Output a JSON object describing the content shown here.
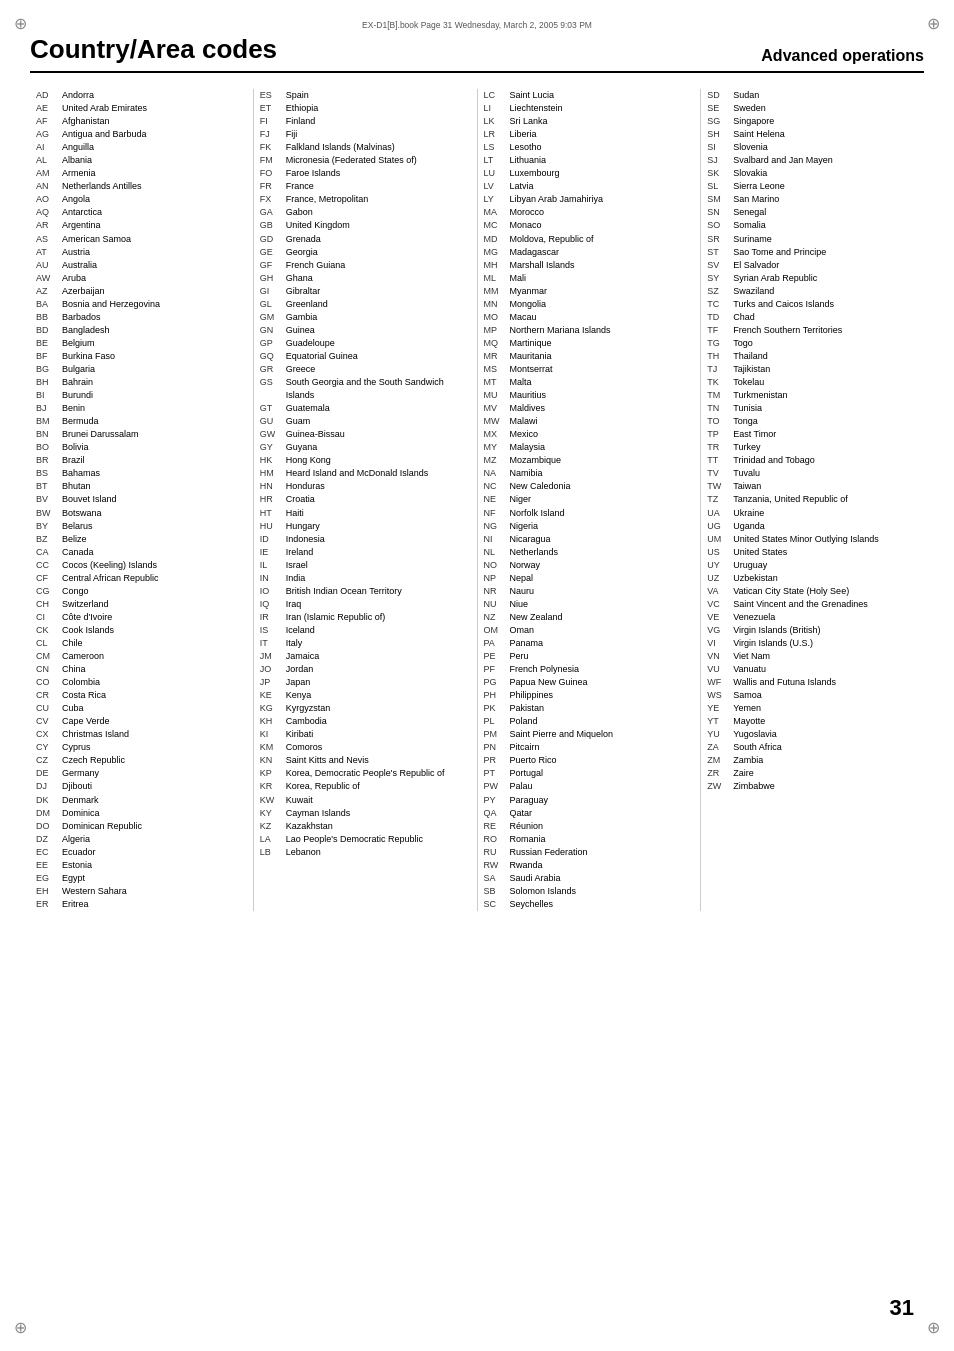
{
  "meta": {
    "top_info": "EX-D1[B].book  Page 31  Wednesday, March 2, 2005  9:03 PM",
    "title": "Country/Area codes",
    "subtitle": "Advanced operations",
    "page_number": "31"
  },
  "columns": [
    [
      {
        "code": "AD",
        "name": "Andorra"
      },
      {
        "code": "AE",
        "name": "United Arab Emirates"
      },
      {
        "code": "AF",
        "name": "Afghanistan"
      },
      {
        "code": "AG",
        "name": "Antigua and Barbuda"
      },
      {
        "code": "AI",
        "name": "Anguilla"
      },
      {
        "code": "AL",
        "name": "Albania"
      },
      {
        "code": "AM",
        "name": "Armenia"
      },
      {
        "code": "AN",
        "name": "Netherlands Antilles"
      },
      {
        "code": "AO",
        "name": "Angola"
      },
      {
        "code": "AQ",
        "name": "Antarctica"
      },
      {
        "code": "AR",
        "name": "Argentina"
      },
      {
        "code": "AS",
        "name": "American Samoa"
      },
      {
        "code": "AT",
        "name": "Austria"
      },
      {
        "code": "AU",
        "name": "Australia"
      },
      {
        "code": "AW",
        "name": "Aruba"
      },
      {
        "code": "AZ",
        "name": "Azerbaijan"
      },
      {
        "code": "BA",
        "name": "Bosnia and Herzegovina"
      },
      {
        "code": "BB",
        "name": "Barbados"
      },
      {
        "code": "BD",
        "name": "Bangladesh"
      },
      {
        "code": "BE",
        "name": "Belgium"
      },
      {
        "code": "BF",
        "name": "Burkina Faso"
      },
      {
        "code": "BG",
        "name": "Bulgaria"
      },
      {
        "code": "BH",
        "name": "Bahrain"
      },
      {
        "code": "BI",
        "name": "Burundi"
      },
      {
        "code": "BJ",
        "name": "Benin"
      },
      {
        "code": "BM",
        "name": "Bermuda"
      },
      {
        "code": "BN",
        "name": "Brunei Darussalam"
      },
      {
        "code": "BO",
        "name": "Bolivia"
      },
      {
        "code": "BR",
        "name": "Brazil"
      },
      {
        "code": "BS",
        "name": "Bahamas"
      },
      {
        "code": "BT",
        "name": "Bhutan"
      },
      {
        "code": "BV",
        "name": "Bouvet Island"
      },
      {
        "code": "BW",
        "name": "Botswana"
      },
      {
        "code": "BY",
        "name": "Belarus"
      },
      {
        "code": "BZ",
        "name": "Belize"
      },
      {
        "code": "CA",
        "name": "Canada"
      },
      {
        "code": "CC",
        "name": "Cocos (Keeling) Islands"
      },
      {
        "code": "CF",
        "name": "Central African Republic"
      },
      {
        "code": "CG",
        "name": "Congo"
      },
      {
        "code": "CH",
        "name": "Switzerland"
      },
      {
        "code": "CI",
        "name": "Côte d'Ivoire"
      },
      {
        "code": "CK",
        "name": "Cook Islands"
      },
      {
        "code": "CL",
        "name": "Chile"
      },
      {
        "code": "CM",
        "name": "Cameroon"
      },
      {
        "code": "CN",
        "name": "China"
      },
      {
        "code": "CO",
        "name": "Colombia"
      },
      {
        "code": "CR",
        "name": "Costa Rica"
      },
      {
        "code": "CU",
        "name": "Cuba"
      },
      {
        "code": "CV",
        "name": "Cape Verde"
      },
      {
        "code": "CX",
        "name": "Christmas Island"
      },
      {
        "code": "CY",
        "name": "Cyprus"
      },
      {
        "code": "CZ",
        "name": "Czech Republic"
      },
      {
        "code": "DE",
        "name": "Germany"
      },
      {
        "code": "DJ",
        "name": "Djibouti"
      },
      {
        "code": "DK",
        "name": "Denmark"
      },
      {
        "code": "DM",
        "name": "Dominica"
      },
      {
        "code": "DO",
        "name": "Dominican Republic"
      },
      {
        "code": "DZ",
        "name": "Algeria"
      },
      {
        "code": "EC",
        "name": "Ecuador"
      },
      {
        "code": "EE",
        "name": "Estonia"
      },
      {
        "code": "EG",
        "name": "Egypt"
      },
      {
        "code": "EH",
        "name": "Western Sahara"
      },
      {
        "code": "ER",
        "name": "Eritrea"
      }
    ],
    [
      {
        "code": "ES",
        "name": "Spain"
      },
      {
        "code": "ET",
        "name": "Ethiopia"
      },
      {
        "code": "FI",
        "name": "Finland"
      },
      {
        "code": "FJ",
        "name": "Fiji"
      },
      {
        "code": "FK",
        "name": "Falkland Islands (Malvinas)"
      },
      {
        "code": "FM",
        "name": "Micronesia (Federated States of)"
      },
      {
        "code": "FO",
        "name": "Faroe Islands"
      },
      {
        "code": "FR",
        "name": "France"
      },
      {
        "code": "FX",
        "name": "France, Metropolitan"
      },
      {
        "code": "GA",
        "name": "Gabon"
      },
      {
        "code": "GB",
        "name": "United Kingdom"
      },
      {
        "code": "GD",
        "name": "Grenada"
      },
      {
        "code": "GE",
        "name": "Georgia"
      },
      {
        "code": "GF",
        "name": "French Guiana"
      },
      {
        "code": "GH",
        "name": "Ghana"
      },
      {
        "code": "GI",
        "name": "Gibraltar"
      },
      {
        "code": "GL",
        "name": "Greenland"
      },
      {
        "code": "GM",
        "name": "Gambia"
      },
      {
        "code": "GN",
        "name": "Guinea"
      },
      {
        "code": "GP",
        "name": "Guadeloupe"
      },
      {
        "code": "GQ",
        "name": "Equatorial Guinea"
      },
      {
        "code": "GR",
        "name": "Greece"
      },
      {
        "code": "GS",
        "name": "South Georgia and the South Sandwich Islands"
      },
      {
        "code": "GT",
        "name": "Guatemala"
      },
      {
        "code": "GU",
        "name": "Guam"
      },
      {
        "code": "GW",
        "name": "Guinea-Bissau"
      },
      {
        "code": "GY",
        "name": "Guyana"
      },
      {
        "code": "HK",
        "name": "Hong Kong"
      },
      {
        "code": "HM",
        "name": "Heard Island and McDonald Islands"
      },
      {
        "code": "HN",
        "name": "Honduras"
      },
      {
        "code": "HR",
        "name": "Croatia"
      },
      {
        "code": "HT",
        "name": "Haiti"
      },
      {
        "code": "HU",
        "name": "Hungary"
      },
      {
        "code": "ID",
        "name": "Indonesia"
      },
      {
        "code": "IE",
        "name": "Ireland"
      },
      {
        "code": "IL",
        "name": "Israel"
      },
      {
        "code": "IN",
        "name": "India"
      },
      {
        "code": "IO",
        "name": "British Indian Ocean Territory"
      },
      {
        "code": "IQ",
        "name": "Iraq"
      },
      {
        "code": "IR",
        "name": "Iran (Islamic Republic of)"
      },
      {
        "code": "IS",
        "name": "Iceland"
      },
      {
        "code": "IT",
        "name": "Italy"
      },
      {
        "code": "JM",
        "name": "Jamaica"
      },
      {
        "code": "JO",
        "name": "Jordan"
      },
      {
        "code": "JP",
        "name": "Japan"
      },
      {
        "code": "KE",
        "name": "Kenya"
      },
      {
        "code": "KG",
        "name": "Kyrgyzstan"
      },
      {
        "code": "KH",
        "name": "Cambodia"
      },
      {
        "code": "KI",
        "name": "Kiribati"
      },
      {
        "code": "KM",
        "name": "Comoros"
      },
      {
        "code": "KN",
        "name": "Saint Kitts and Nevis"
      },
      {
        "code": "KP",
        "name": "Korea, Democratic People's Republic of"
      },
      {
        "code": "KR",
        "name": "Korea, Republic of"
      },
      {
        "code": "KW",
        "name": "Kuwait"
      },
      {
        "code": "KY",
        "name": "Cayman Islands"
      },
      {
        "code": "KZ",
        "name": "Kazakhstan"
      },
      {
        "code": "LA",
        "name": "Lao People's Democratic Republic"
      },
      {
        "code": "LB",
        "name": "Lebanon"
      }
    ],
    [
      {
        "code": "LC",
        "name": "Saint Lucia"
      },
      {
        "code": "LI",
        "name": "Liechtenstein"
      },
      {
        "code": "LK",
        "name": "Sri Lanka"
      },
      {
        "code": "LR",
        "name": "Liberia"
      },
      {
        "code": "LS",
        "name": "Lesotho"
      },
      {
        "code": "LT",
        "name": "Lithuania"
      },
      {
        "code": "LU",
        "name": "Luxembourg"
      },
      {
        "code": "LV",
        "name": "Latvia"
      },
      {
        "code": "LY",
        "name": "Libyan Arab Jamahiriya"
      },
      {
        "code": "MA",
        "name": "Morocco"
      },
      {
        "code": "MC",
        "name": "Monaco"
      },
      {
        "code": "MD",
        "name": "Moldova, Republic of"
      },
      {
        "code": "MG",
        "name": "Madagascar"
      },
      {
        "code": "MH",
        "name": "Marshall Islands"
      },
      {
        "code": "ML",
        "name": "Mali"
      },
      {
        "code": "MM",
        "name": "Myanmar"
      },
      {
        "code": "MN",
        "name": "Mongolia"
      },
      {
        "code": "MO",
        "name": "Macau"
      },
      {
        "code": "MP",
        "name": "Northern Mariana Islands"
      },
      {
        "code": "MQ",
        "name": "Martinique"
      },
      {
        "code": "MR",
        "name": "Mauritania"
      },
      {
        "code": "MS",
        "name": "Montserrat"
      },
      {
        "code": "MT",
        "name": "Malta"
      },
      {
        "code": "MU",
        "name": "Mauritius"
      },
      {
        "code": "MV",
        "name": "Maldives"
      },
      {
        "code": "MW",
        "name": "Malawi"
      },
      {
        "code": "MX",
        "name": "Mexico"
      },
      {
        "code": "MY",
        "name": "Malaysia"
      },
      {
        "code": "MZ",
        "name": "Mozambique"
      },
      {
        "code": "NA",
        "name": "Namibia"
      },
      {
        "code": "NC",
        "name": "New Caledonia"
      },
      {
        "code": "NE",
        "name": "Niger"
      },
      {
        "code": "NF",
        "name": "Norfolk Island"
      },
      {
        "code": "NG",
        "name": "Nigeria"
      },
      {
        "code": "NI",
        "name": "Nicaragua"
      },
      {
        "code": "NL",
        "name": "Netherlands"
      },
      {
        "code": "NO",
        "name": "Norway"
      },
      {
        "code": "NP",
        "name": "Nepal"
      },
      {
        "code": "NR",
        "name": "Nauru"
      },
      {
        "code": "NU",
        "name": "Niue"
      },
      {
        "code": "NZ",
        "name": "New Zealand"
      },
      {
        "code": "OM",
        "name": "Oman"
      },
      {
        "code": "PA",
        "name": "Panama"
      },
      {
        "code": "PE",
        "name": "Peru"
      },
      {
        "code": "PF",
        "name": "French Polynesia"
      },
      {
        "code": "PG",
        "name": "Papua New Guinea"
      },
      {
        "code": "PH",
        "name": "Philippines"
      },
      {
        "code": "PK",
        "name": "Pakistan"
      },
      {
        "code": "PL",
        "name": "Poland"
      },
      {
        "code": "PM",
        "name": "Saint Pierre and Miquelon"
      },
      {
        "code": "PN",
        "name": "Pitcairn"
      },
      {
        "code": "PR",
        "name": "Puerto Rico"
      },
      {
        "code": "PT",
        "name": "Portugal"
      },
      {
        "code": "PW",
        "name": "Palau"
      },
      {
        "code": "PY",
        "name": "Paraguay"
      },
      {
        "code": "QA",
        "name": "Qatar"
      },
      {
        "code": "RE",
        "name": "Réunion"
      },
      {
        "code": "RO",
        "name": "Romania"
      },
      {
        "code": "RU",
        "name": "Russian Federation"
      },
      {
        "code": "RW",
        "name": "Rwanda"
      },
      {
        "code": "SA",
        "name": "Saudi Arabia"
      },
      {
        "code": "SB",
        "name": "Solomon Islands"
      },
      {
        "code": "SC",
        "name": "Seychelles"
      }
    ],
    [
      {
        "code": "SD",
        "name": "Sudan"
      },
      {
        "code": "SE",
        "name": "Sweden"
      },
      {
        "code": "SG",
        "name": "Singapore"
      },
      {
        "code": "SH",
        "name": "Saint Helena"
      },
      {
        "code": "SI",
        "name": "Slovenia"
      },
      {
        "code": "SJ",
        "name": "Svalbard and Jan Mayen"
      },
      {
        "code": "SK",
        "name": "Slovakia"
      },
      {
        "code": "SL",
        "name": "Sierra Leone"
      },
      {
        "code": "SM",
        "name": "San Marino"
      },
      {
        "code": "SN",
        "name": "Senegal"
      },
      {
        "code": "SO",
        "name": "Somalia"
      },
      {
        "code": "SR",
        "name": "Suriname"
      },
      {
        "code": "ST",
        "name": "Sao Tome and Principe"
      },
      {
        "code": "SV",
        "name": "El Salvador"
      },
      {
        "code": "SY",
        "name": "Syrian Arab Republic"
      },
      {
        "code": "SZ",
        "name": "Swaziland"
      },
      {
        "code": "TC",
        "name": "Turks and Caicos Islands"
      },
      {
        "code": "TD",
        "name": "Chad"
      },
      {
        "code": "TF",
        "name": "French Southern Territories"
      },
      {
        "code": "TG",
        "name": "Togo"
      },
      {
        "code": "TH",
        "name": "Thailand"
      },
      {
        "code": "TJ",
        "name": "Tajikistan"
      },
      {
        "code": "TK",
        "name": "Tokelau"
      },
      {
        "code": "TM",
        "name": "Turkmenistan"
      },
      {
        "code": "TN",
        "name": "Tunisia"
      },
      {
        "code": "TO",
        "name": "Tonga"
      },
      {
        "code": "TP",
        "name": "East Timor"
      },
      {
        "code": "TR",
        "name": "Turkey"
      },
      {
        "code": "TT",
        "name": "Trinidad and Tobago"
      },
      {
        "code": "TV",
        "name": "Tuvalu"
      },
      {
        "code": "TW",
        "name": "Taiwan"
      },
      {
        "code": "TZ",
        "name": "Tanzania, United Republic of"
      },
      {
        "code": "UA",
        "name": "Ukraine"
      },
      {
        "code": "UG",
        "name": "Uganda"
      },
      {
        "code": "UM",
        "name": "United States Minor Outlying Islands"
      },
      {
        "code": "US",
        "name": "United States"
      },
      {
        "code": "UY",
        "name": "Uruguay"
      },
      {
        "code": "UZ",
        "name": "Uzbekistan"
      },
      {
        "code": "VA",
        "name": "Vatican City State (Holy See)"
      },
      {
        "code": "VC",
        "name": "Saint Vincent and the Grenadines"
      },
      {
        "code": "VE",
        "name": "Venezuela"
      },
      {
        "code": "VG",
        "name": "Virgin Islands (British)"
      },
      {
        "code": "VI",
        "name": "Virgin Islands (U.S.)"
      },
      {
        "code": "VN",
        "name": "Viet Nam"
      },
      {
        "code": "VU",
        "name": "Vanuatu"
      },
      {
        "code": "WF",
        "name": "Wallis and Futuna Islands"
      },
      {
        "code": "WS",
        "name": "Samoa"
      },
      {
        "code": "YE",
        "name": "Yemen"
      },
      {
        "code": "YT",
        "name": "Mayotte"
      },
      {
        "code": "YU",
        "name": "Yugoslavia"
      },
      {
        "code": "ZA",
        "name": "South Africa"
      },
      {
        "code": "ZM",
        "name": "Zambia"
      },
      {
        "code": "ZR",
        "name": "Zaire"
      },
      {
        "code": "ZW",
        "name": "Zimbabwe"
      }
    ]
  ]
}
